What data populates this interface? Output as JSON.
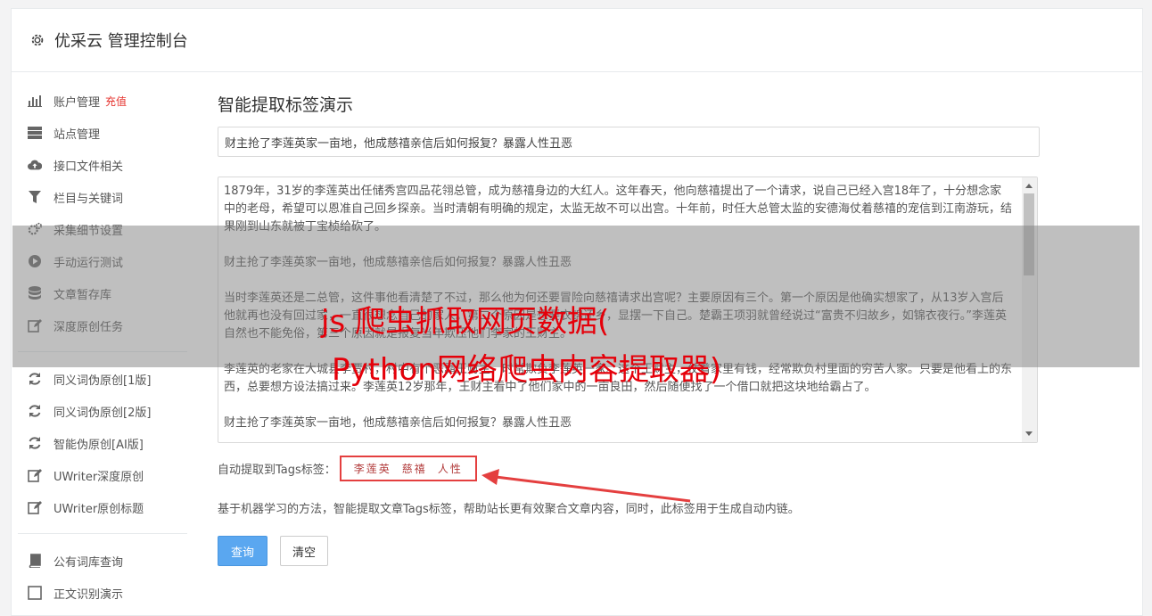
{
  "header": {
    "title": "优采云 管理控制台"
  },
  "sidebar": {
    "group1": [
      {
        "label": "账户管理",
        "extra": "充值",
        "icon": "bar-chart-icon"
      },
      {
        "label": "站点管理",
        "icon": "server-icon"
      },
      {
        "label": "接口文件相关",
        "icon": "cloud-upload-icon"
      },
      {
        "label": "栏目与关键词",
        "icon": "filter-icon"
      },
      {
        "label": "采集细节设置",
        "icon": "cogs-icon"
      },
      {
        "label": "手动运行测试",
        "icon": "play-circle-icon"
      },
      {
        "label": "文章暂存库",
        "icon": "database-icon"
      },
      {
        "label": "深度原创任务",
        "icon": "edit-icon"
      }
    ],
    "group2": [
      {
        "label": "同义词伪原创[1版]",
        "icon": "refresh-icon"
      },
      {
        "label": "同义词伪原创[2版]",
        "icon": "refresh-icon"
      },
      {
        "label": "智能伪原创[AI版]",
        "icon": "refresh-icon"
      },
      {
        "label": "UWriter深度原创",
        "icon": "edit-icon"
      },
      {
        "label": "UWriter原创标题",
        "icon": "edit-icon"
      }
    ],
    "group3": [
      {
        "label": "公有词库查询",
        "icon": "book-icon"
      },
      {
        "label": "正文识别演示",
        "icon": "square-icon"
      }
    ]
  },
  "main": {
    "title": "智能提取标签演示",
    "title_input": "财主抢了李莲英家一亩地，他成慈禧亲信后如何报复？暴露人性丑恶",
    "body_paragraphs": [
      "1879年，31岁的李莲英出任储秀宫四品花翎总管，成为慈禧身边的大红人。这年春天，他向慈禧提出了一个请求，说自己已经入宫18年了，十分想念家中的老母，希望可以恩准自己回乡探亲。当时清朝有明确的规定，太监无故不可以出宫。十年前，时任大总管太监的安德海仗着慈禧的宠信到江南游玩，结果刚到山东就被丁宝桢给砍了。",
      "财主抢了李莲英家一亩地，他成慈禧亲信后如何报复？暴露人性丑恶",
      "当时李莲英还是二总管，这件事他看清楚了不过，那么他为何还要冒险向慈禧请求出宫呢？主要原因有三个。第一个原因是他确实想家了，从13岁入宫后他就再也没有回过家，一直很想念自己的家人。第二个原因是想要衣锦还乡，显摆一下自己。楚霸王项羽就曾经说过“富贵不归故乡，如锦衣夜行。”李莲英自然也不能免俗，第三个原因就是报复当年欺压他们李家的王财主。",
      "李莲英的老家在大城县李贾村，村中有个恶霸王财主，时常欺负李莲英一家。这个王财主，仗着家里有钱，经常欺负村里面的穷苦人家。只要是他看上的东西，总要想方设法搞过来。李莲英12岁那年，王财主看中了他们家中的一亩良田，然后随便找了一个借口就把这块地给霸占了。",
      "财主抢了李莲英家一亩地，他成慈禧亲信后如何报复？暴露人性丑恶"
    ],
    "tags_label": "自动提取到Tags标签：",
    "tags": [
      "李莲英",
      "慈禧",
      "人性"
    ],
    "description": "基于机器学习的方法，智能提取文章Tags标签，帮助站长更有效聚合文章内容，同时，此标签用于生成自动内链。",
    "query_button": "查询",
    "clear_button": "清空"
  },
  "overlay": {
    "line1": "js 爬虫抓取网页数据(",
    "line2": "Python网络爬虫内容提取器)"
  },
  "colors": {
    "accent_red": "#e5322d",
    "primary_blue": "#5aa7f0"
  }
}
